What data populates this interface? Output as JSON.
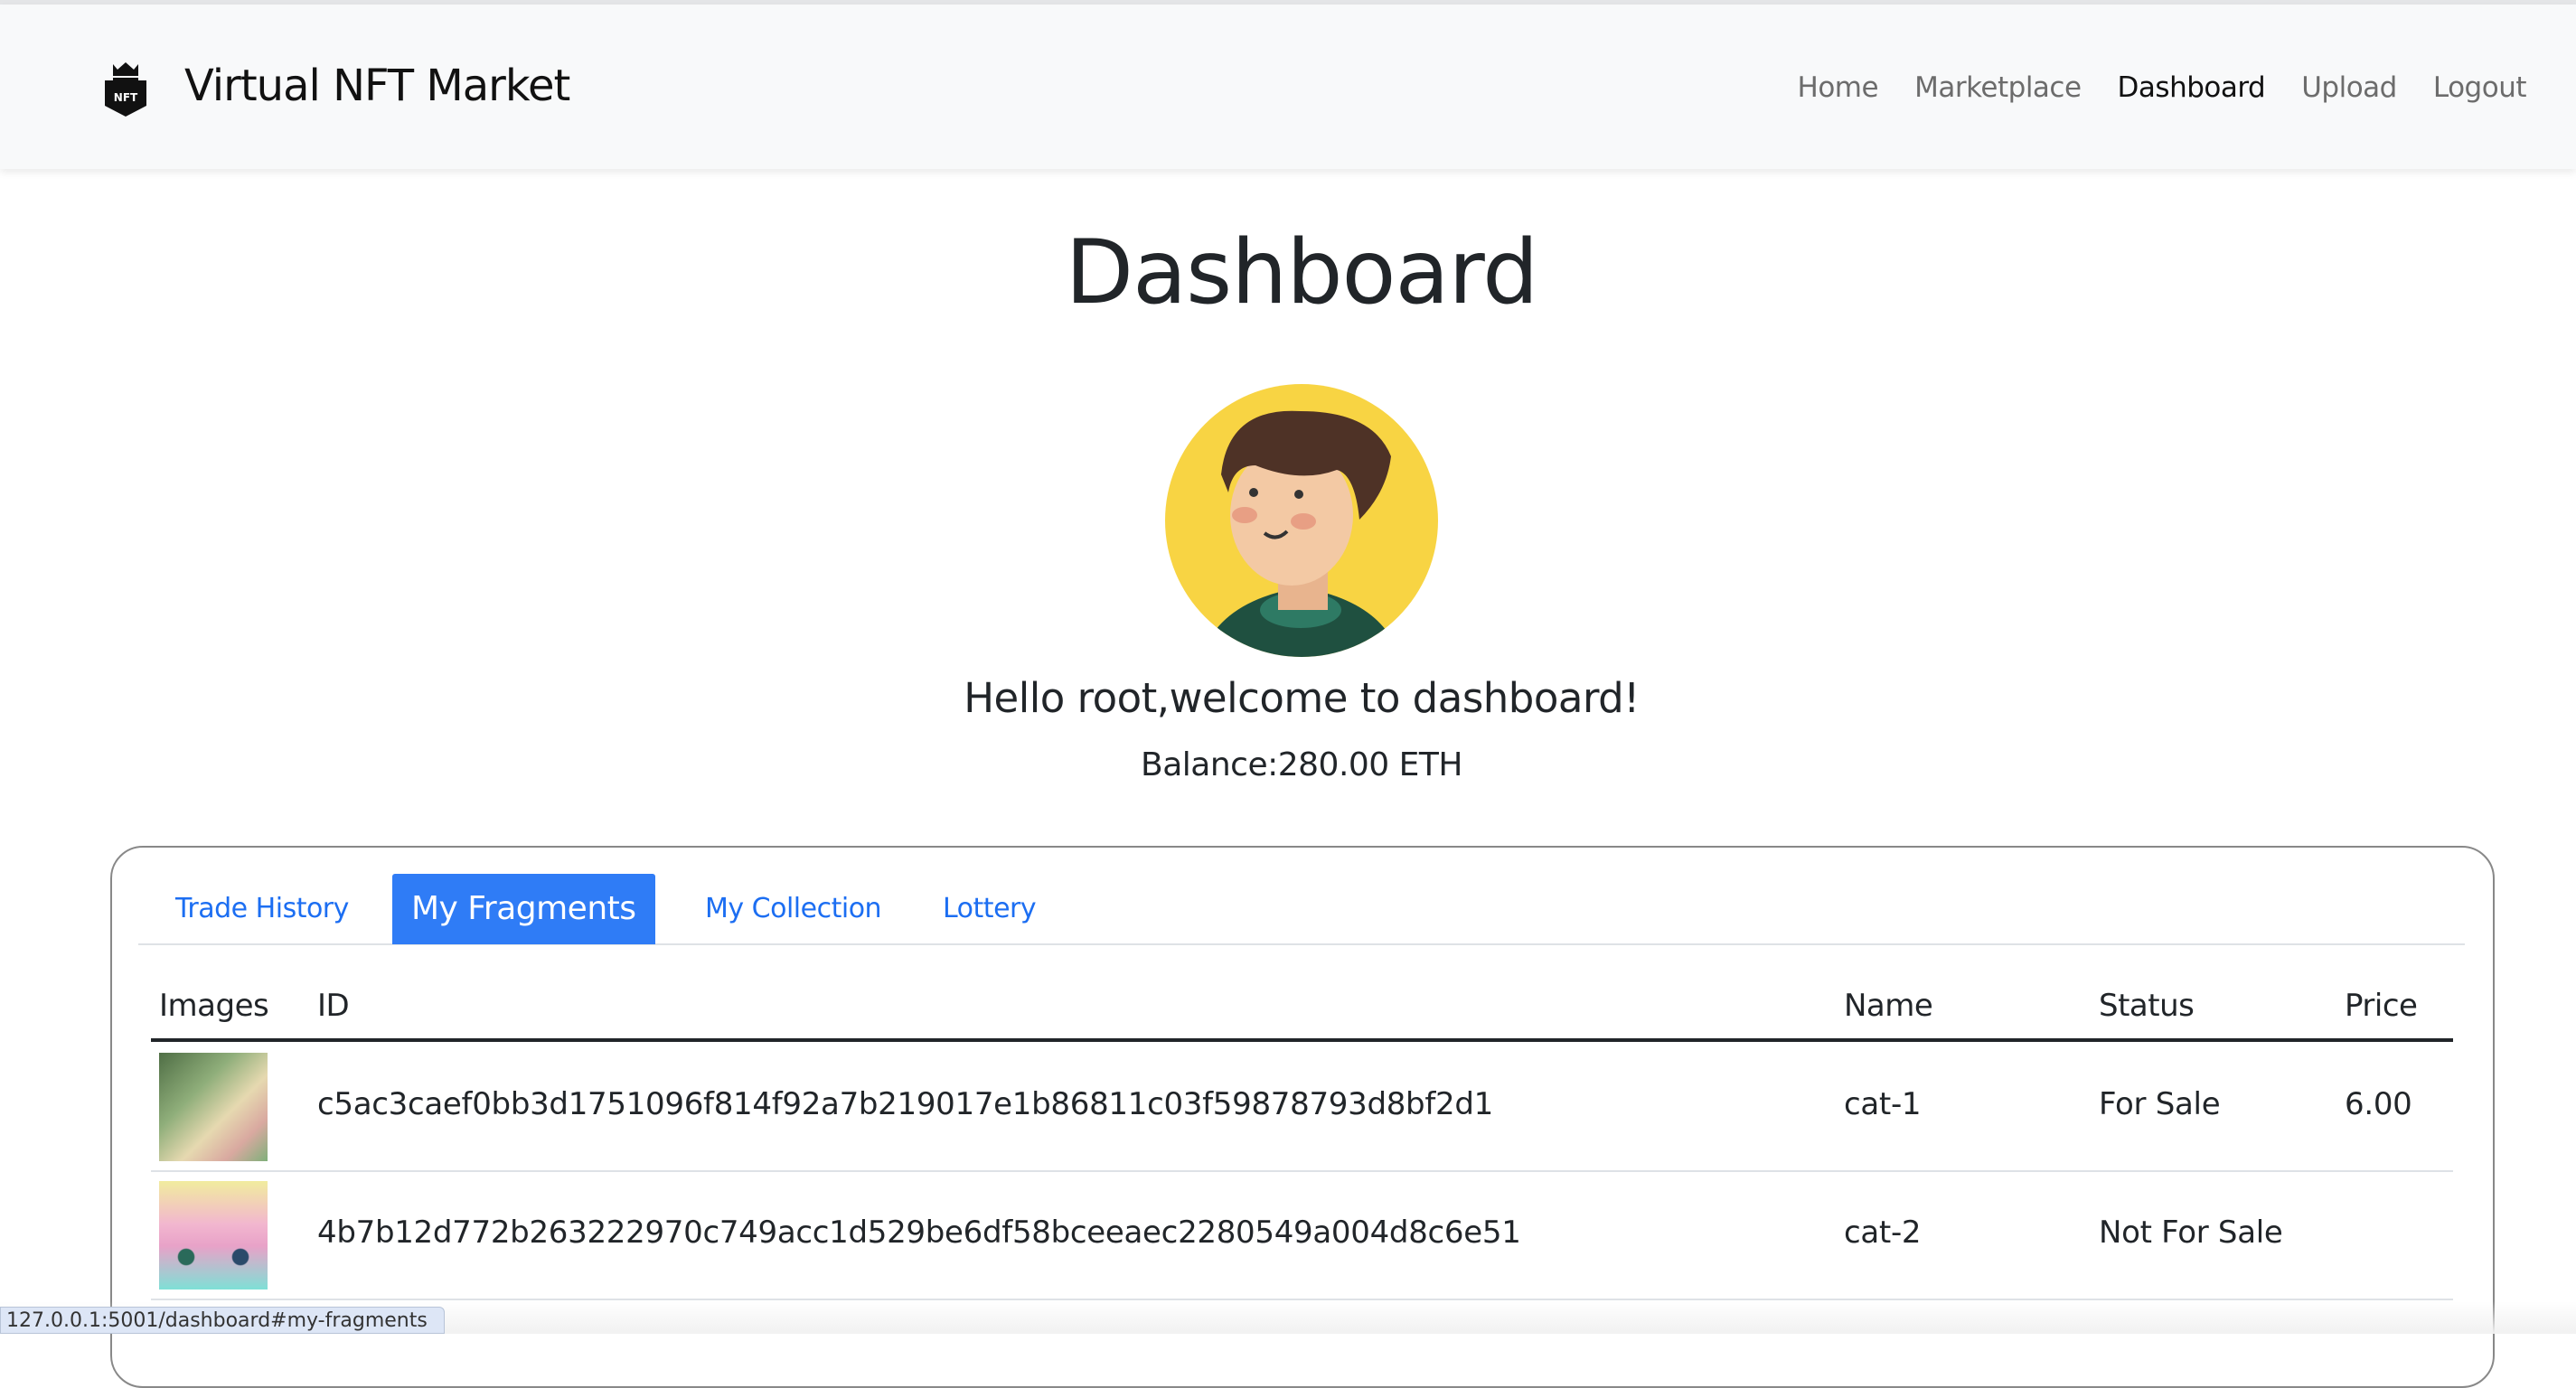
{
  "navbar": {
    "brand": "Virtual NFT Market",
    "logo_text": "NFT",
    "links": [
      "Home",
      "Marketplace",
      "Dashboard",
      "Upload",
      "Logout"
    ],
    "active": "Dashboard"
  },
  "page": {
    "title": "Dashboard",
    "greeting": "Hello root,welcome to dashboard!",
    "balance": "Balance:280.00 ETH"
  },
  "tabs": [
    "Trade History",
    "My Fragments",
    "My Collection",
    "Lottery"
  ],
  "table": {
    "headers": [
      "Images",
      "ID",
      "Name",
      "Status",
      "Price"
    ],
    "rows": [
      {
        "id": "c5ac3caef0bb3d1751096f814f92a7b219017e1b86811c03f59878793d8bf2d1",
        "name": "cat-1",
        "status": "For Sale",
        "price": "6.00"
      },
      {
        "id": "4b7b12d772b263222970c749acc1d529be6df58bceeaec2280549a004d8c6e51",
        "name": "cat-2",
        "status": "Not For Sale",
        "price": ""
      }
    ]
  },
  "status_bar": "127.0.0.1:5001/dashboard#my-fragments",
  "colors": {
    "accent": "#2f7cf6",
    "navbar_bg": "#f8f9fa",
    "avatar_bg": "#f8d443"
  }
}
